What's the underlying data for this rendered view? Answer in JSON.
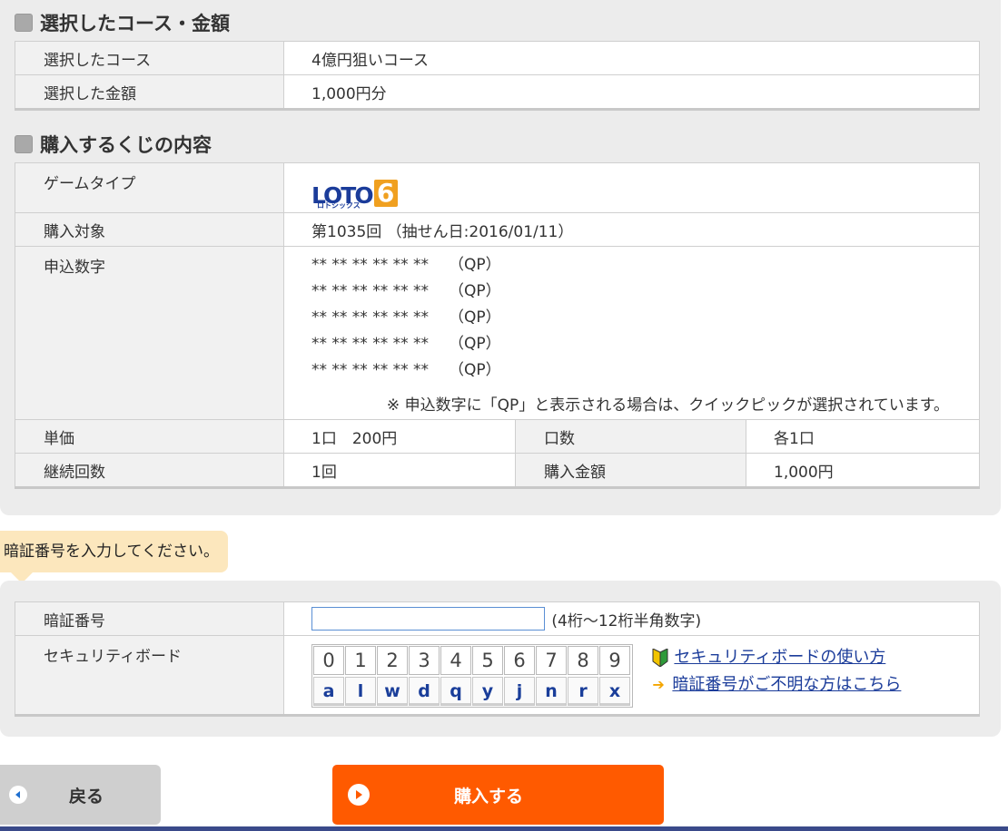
{
  "section1": {
    "title": "選択したコース・金額",
    "rows": [
      {
        "label": "選択したコース",
        "value": "4億円狙いコース"
      },
      {
        "label": "選択した金額",
        "value": "1,000円分"
      }
    ]
  },
  "section2": {
    "title": "購入するくじの内容",
    "game_type_label": "ゲームタイプ",
    "game_logo": {
      "main": "LOTO",
      "num": "6",
      "sub": "ロトシックス"
    },
    "target_label": "購入対象",
    "target_value": "第1035回 （抽せん日:2016/01/11）",
    "numbers_label": "申込数字",
    "numbers": [
      {
        "nums": "** ** ** ** ** **",
        "qp": "（QP）"
      },
      {
        "nums": "** ** ** ** ** **",
        "qp": "（QP）"
      },
      {
        "nums": "** ** ** ** ** **",
        "qp": "（QP）"
      },
      {
        "nums": "** ** ** ** ** **",
        "qp": "（QP）"
      },
      {
        "nums": "** ** ** ** ** **",
        "qp": "（QP）"
      }
    ],
    "note": "※ 申込数字に「QP」と表示される場合は、クイックピックが選択されています。",
    "unit_price_label": "単価",
    "unit_price_value": "1口　200円",
    "units_label": "口数",
    "units_value": "各1口",
    "continuation_label": "継続回数",
    "continuation_value": "1回",
    "amount_label": "購入金額",
    "amount_value": "1,000円"
  },
  "pin_prompt": "暗証番号を入力してください。",
  "pin": {
    "label": "暗証番号",
    "value": "",
    "hint": "(4桁〜12桁半角数字)"
  },
  "security_board": {
    "label": "セキュリティボード",
    "digits": [
      "0",
      "1",
      "2",
      "3",
      "4",
      "5",
      "6",
      "7",
      "8",
      "9"
    ],
    "letters": [
      "a",
      "l",
      "w",
      "d",
      "q",
      "y",
      "j",
      "n",
      "r",
      "x"
    ],
    "link_howto": "セキュリティボードの使い方",
    "link_forgot": "暗証番号がご不明な方はこちら"
  },
  "buttons": {
    "back": "戻る",
    "buy": "購入する"
  },
  "colors": {
    "buy": "#ff5a00",
    "panel": "#ececec",
    "link": "#1b3c9a"
  }
}
